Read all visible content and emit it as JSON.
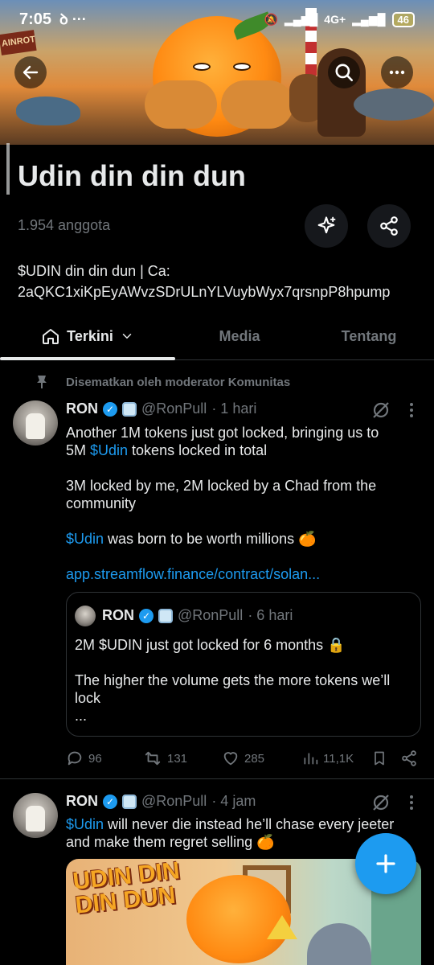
{
  "status_bar": {
    "time": "7:05",
    "left_icons": "ꝺ ···",
    "network": "4G+",
    "battery": "46"
  },
  "community": {
    "name": "Udin din din dun",
    "members": "1.954 anggota",
    "description_line1": "$UDIN din din dun | Ca:",
    "description_line2": "2aQKC1xiKpEyAWvzSDrULnYLVuybWyx7qrsnpP8hpump"
  },
  "tabs": [
    {
      "label": "Terkini",
      "active": true
    },
    {
      "label": "Media",
      "active": false
    },
    {
      "label": "Tentang",
      "active": false
    }
  ],
  "pinned_label": "Disematkan oleh moderator Komunitas",
  "posts": [
    {
      "name": "RON",
      "handle": "@RonPull",
      "time": "· 1 hari",
      "lines": [
        {
          "pre": "Another 1M tokens just got locked, bringing us to",
          "link": "",
          "post": ""
        },
        {
          "pre": "5M ",
          "link": "$Udin",
          "post": " tokens locked in total"
        },
        {
          "pre": "3M locked by me, 2M locked by a Chad from the",
          "link": "",
          "post": ""
        },
        {
          "pre": "community",
          "link": "",
          "post": ""
        },
        {
          "pre": "",
          "link": "$Udin",
          "post": " was born to be worth millions 🍊"
        },
        {
          "pre": "",
          "link": "app.streamflow.finance/contract/solan...",
          "post": ""
        }
      ],
      "quote": {
        "name": "RON",
        "handle": "@RonPull",
        "time": "· 6 hari",
        "line1": "2M $UDIN just got locked for 6 months 🔒",
        "line2": "The higher the volume gets the more tokens we’ll",
        "line3": "lock",
        "line4": "..."
      },
      "stats": {
        "replies": "96",
        "reposts": "131",
        "likes": "285",
        "views": "11,1K"
      }
    },
    {
      "name": "RON",
      "handle": "@RonPull",
      "time": "· 4 jam",
      "line1_link": "$Udin",
      "line1_rest": " will never die instead he’ll chase every jeeter",
      "line2": "and make them regret selling 🍊",
      "media_text": "UDIN DIN DIN DUN"
    }
  ],
  "colors": {
    "accent": "#1d9bf0",
    "muted": "#71767b",
    "text": "#e7e9ea",
    "background": "#000000"
  }
}
